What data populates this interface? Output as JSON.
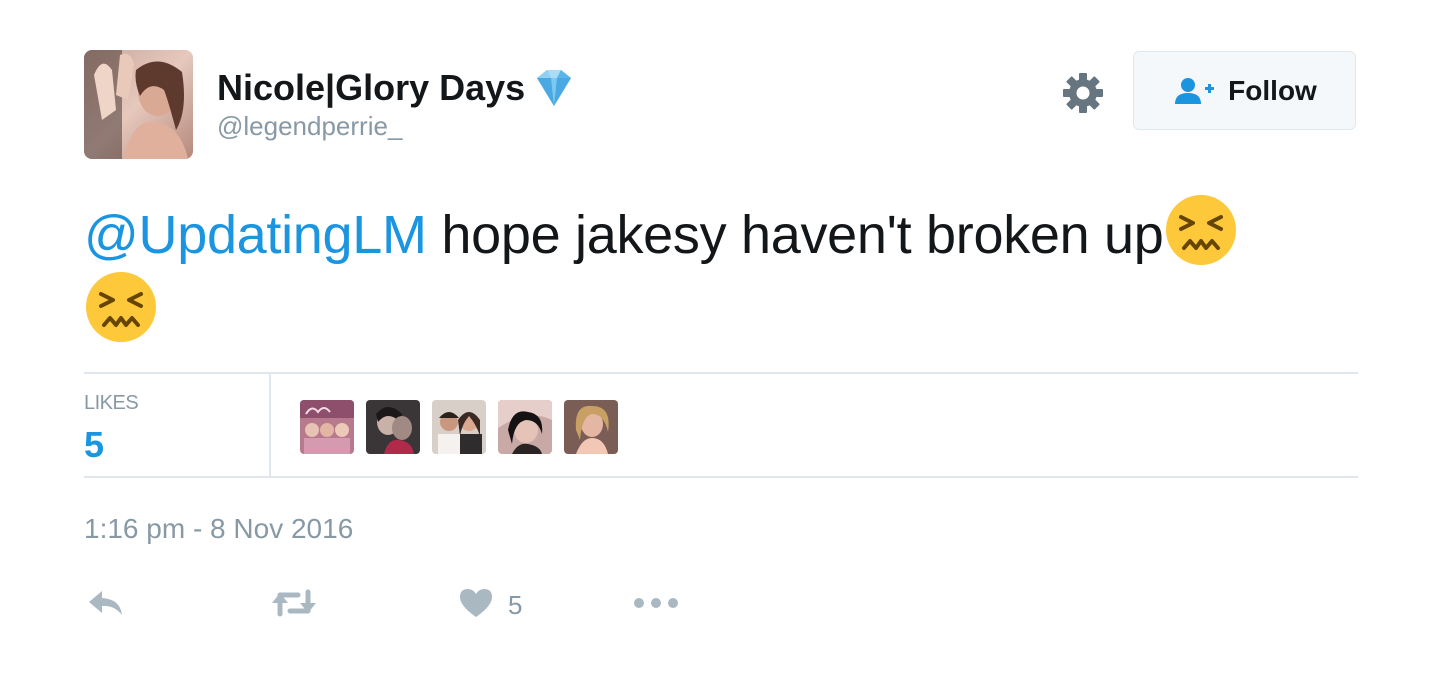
{
  "author": {
    "display_name": "Nicole|Glory Days",
    "handle": "@legendperrie_",
    "badge_icon": "gem-stone-icon"
  },
  "header": {
    "settings_icon": "gear-icon",
    "follow_label": "Follow",
    "follow_icon": "follow-person-plus-icon"
  },
  "tweet": {
    "mention": "@UpdatingLM",
    "text": " hope jakesy haven't broken up",
    "emoji": "confounded-face-emoji"
  },
  "stats": {
    "likes_label": "LIKES",
    "likes_count": "5"
  },
  "timestamp": "1:16 pm - 8 Nov 2016",
  "actions": {
    "like_count": "5"
  },
  "colors": {
    "link_blue": "#1b95e0",
    "muted_gray": "#8899a6",
    "border": "#e1e8ed",
    "text": "#14171a",
    "emoji_yellow": "#fdc83a"
  }
}
